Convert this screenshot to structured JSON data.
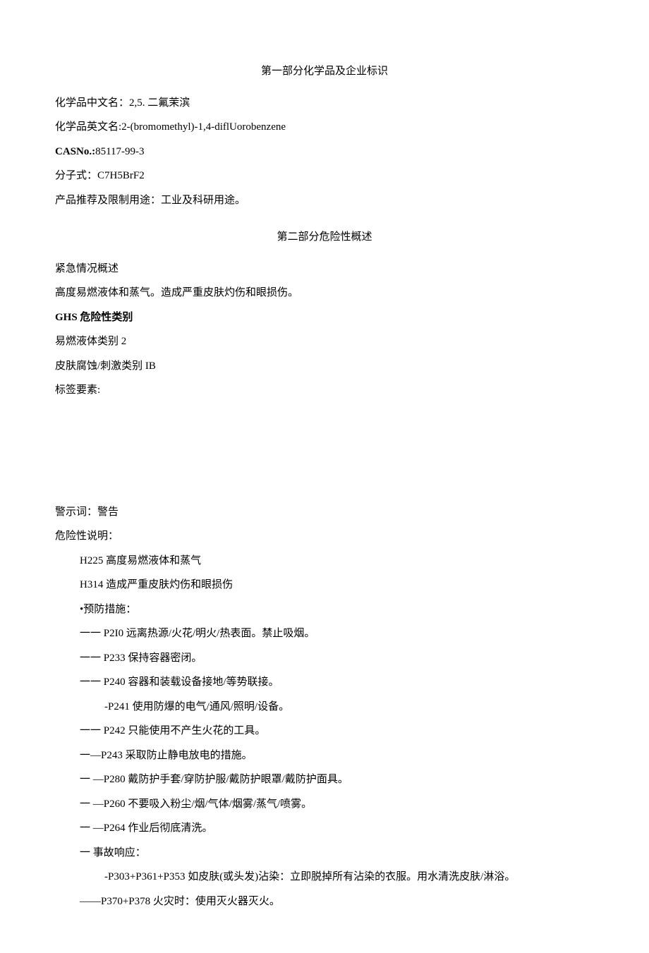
{
  "section1": {
    "heading": "第一部分化学品及企业标识",
    "name_cn_label": "化学品中文名：",
    "name_cn_value": "2,5. 二氟茉滨",
    "name_en_label": "化学品英文名:",
    "name_en_value": "2-(bromomethyl)-1,4-diflUorobenzene",
    "cas_label": "CASNo.:",
    "cas_value": "85117-99-3",
    "formula_label": "分子式：",
    "formula_value": "C7H5BrF2",
    "usage_label": "产品推荐及限制用途：",
    "usage_value": "工业及科研用途。"
  },
  "section2": {
    "heading": "第二部分危险性概述",
    "emergency_label": "紧急情况概述",
    "emergency_text": "高度易燃液体和蒸气。造成严重皮肤灼伤和眼损伤。",
    "ghs_label": "GHS 危险性类别",
    "ghs_cat1": "易燃液体类别 2",
    "ghs_cat2": "皮肤腐蚀/刺激类别 IB",
    "label_elements": "标签要素:",
    "signal_label": "警示词：",
    "signal_value": "警告",
    "hazard_label": "危险性说明：",
    "h225": "H225 高度易燃液体和蒸气",
    "h314": "H314 造成严重皮肤灼伤和眼损伤",
    "prevention_label": "•预防措施：",
    "p210": "一一 P2I0 远离热源/火花/明火/热表面。禁止吸烟。",
    "p233": "一一 P233 保持容器密闭。",
    "p240": "一一 P240 容器和装载设备接地/等势联接。",
    "p241": "-P241 使用防爆的电气/通风/照明/设备。",
    "p242": "一一 P242 只能使用不产生火花的工具。",
    "p243": "一—P243 采取防止静电放电的措施。",
    "p280": "一  —P280 戴防护手套/穿防护服/戴防护眼罩/戴防护面具。",
    "p260": "一  —P260 不要吸入粉尘/烟/气体/烟雾/蒸气/喷雾。",
    "p264": "一  —P264 作业后彻底清洗。",
    "response_label": "一 事故响应：",
    "p303": "-P303+P361+P353 如皮肤(或头发)沾染：立即脱掉所有沾染的衣服。用水清洗皮肤/淋浴。",
    "p370": "——P370+P378 火灾时：使用灭火器灭火。"
  }
}
